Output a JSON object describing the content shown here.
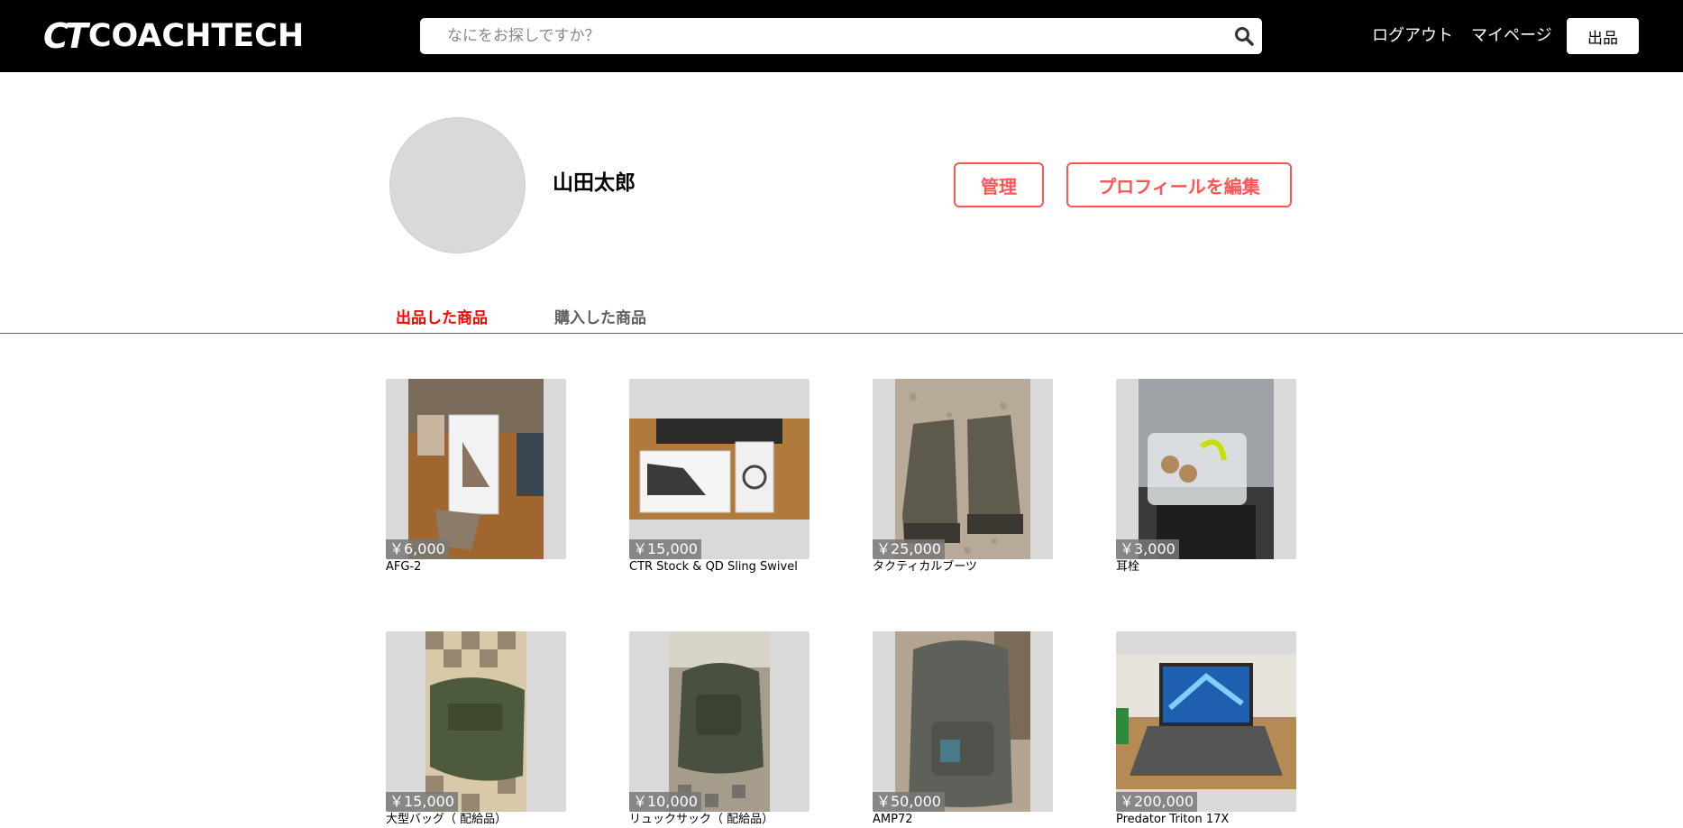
{
  "header": {
    "logo_mark": "CT",
    "logo_text": "COACHTECH",
    "search_placeholder": "なにをお探しですか？",
    "logout_label": "ログアウト",
    "mypage_label": "マイページ",
    "sell_label": "出品"
  },
  "profile": {
    "username": "山田太郎",
    "manage_label": "管理",
    "edit_label": "プロフィールを編集"
  },
  "tabs": {
    "listed_label": "出品した商品",
    "purchased_label": "購入した商品"
  },
  "items": [
    {
      "price": "￥6,000",
      "name": "AFG-2"
    },
    {
      "price": "￥15,000",
      "name": "CTR Stock & QD Sling Swivel"
    },
    {
      "price": "￥25,000",
      "name": "タクティカルブーツ"
    },
    {
      "price": "￥3,000",
      "name": "耳栓"
    },
    {
      "price": "￥15,000",
      "name": "大型バッグ（ 配給品）"
    },
    {
      "price": "￥10,000",
      "name": "リュックサック（ 配給品）"
    },
    {
      "price": "￥50,000",
      "name": "AMP72"
    },
    {
      "price": "￥200,000",
      "name": "Predator Triton 17X"
    }
  ],
  "colors": {
    "header_bg": "#000000",
    "accent_red": "#ff5555",
    "tab_active": "#ff0000",
    "placeholder_gray": "#d9d9d9"
  }
}
